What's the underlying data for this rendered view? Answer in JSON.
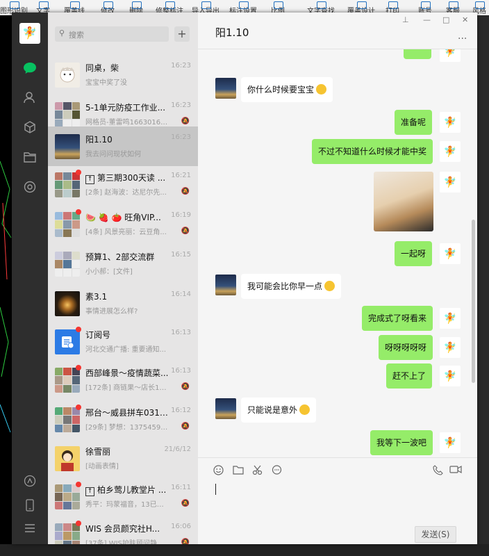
{
  "background_app": {
    "toolbar_items": [
      "图形识别",
      "文字",
      "覆盖线",
      "修改",
      "删除",
      "修整标注",
      "导入导出",
      "标注设置",
      "比例",
      "文字查找",
      "覆盖设计",
      "打印",
      "账号",
      "客服",
      "风格"
    ]
  },
  "window": {
    "title_bar_icons": [
      "pin-icon",
      "minimize-icon",
      "maximize-icon",
      "close-icon"
    ]
  },
  "nav": {
    "icons": [
      "chat-icon",
      "contacts-icon",
      "favorites-icon",
      "files-icon",
      "mini-programs-icon",
      "moments-icon",
      "phone-icon",
      "menu-icon"
    ],
    "active": "chat-icon",
    "accent": "#07c160"
  },
  "search": {
    "placeholder": "搜索",
    "add_button": "+"
  },
  "conversations": [
    {
      "name": "同桌，柴",
      "time": "16:23",
      "preview": "宝宝中奖了没",
      "muted": false,
      "unread_dot": false,
      "avatar": "anime-girl"
    },
    {
      "name": "5-1单元防疫工作业...",
      "time": "16:23",
      "preview": "网格员-董雷鸣16630161...",
      "muted": true,
      "unread_dot": false,
      "avatar": "group-grid"
    },
    {
      "name": "阳1.10",
      "time": "16:23",
      "preview": "我去问问现状如何",
      "muted": false,
      "unread_dot": false,
      "active": true,
      "avatar": "night-sky"
    },
    {
      "name": "第三期300天读 ...",
      "time": "16:21",
      "preview": "[2条] 赵海波：达尼尔先...",
      "muted": true,
      "unread_dot": true,
      "prefix_icon": "pin-box-icon",
      "avatar": "group-grid"
    },
    {
      "name": "🍉 🍓 🍅 旺角VIP...",
      "time": "16:19",
      "preview": "[4条] 风景亮丽：云豆角...",
      "muted": true,
      "unread_dot": true,
      "avatar": "group-grid"
    },
    {
      "name": "预算1、2部交流群",
      "time": "16:15",
      "preview": "小小郝：[文件]",
      "muted": false,
      "unread_dot": false,
      "avatar": "group-grid"
    },
    {
      "name": "素3.1",
      "time": "16:14",
      "preview": "事情进展怎么样?",
      "muted": false,
      "unread_dot": false,
      "avatar": "light-bulb"
    },
    {
      "name": "订阅号",
      "time": "16:13",
      "preview": "河北交通广播: 重要通知...",
      "muted": false,
      "unread_dot": true,
      "avatar": "subscription"
    },
    {
      "name": "西部峰景～疫情蔬菜...",
      "time": "16:13",
      "preview": "[172条] 商链果～店长19...",
      "muted": true,
      "unread_dot": true,
      "avatar": "group-grid"
    },
    {
      "name": "邢台～威县拼车0319...",
      "time": "16:12",
      "preview": "[29条] 梦想：13754592...",
      "muted": true,
      "unread_dot": true,
      "avatar": "group-grid"
    },
    {
      "name": "徐雪丽",
      "time": "21/6/12",
      "preview": "[动画表情]",
      "muted": false,
      "unread_dot": false,
      "avatar": "girl-red"
    },
    {
      "name": "柏乡莺儿教堂片 ...",
      "time": "16:11",
      "preview": "秀平：玛蒙福音，13已读...",
      "muted": true,
      "unread_dot": true,
      "prefix_icon": "pin-box-icon",
      "avatar": "group-grid"
    },
    {
      "name": "WIS 会员颜究社H...",
      "time": "16:06",
      "preview": "[37条] WIS护肤顾问静琪...",
      "muted": true,
      "unread_dot": true,
      "avatar": "group-grid"
    }
  ],
  "chat": {
    "title": "阳1.10",
    "more": "···",
    "messages": [
      {
        "side": "out",
        "text": "",
        "partial": true
      },
      {
        "side": "in",
        "text": "你什么时候要宝宝",
        "emoji": true
      },
      {
        "side": "out",
        "text": "准备呢"
      },
      {
        "side": "out",
        "text": "不过不知道什么时候才能中奖"
      },
      {
        "side": "out",
        "type": "image",
        "text": "cat-photo"
      },
      {
        "side": "out",
        "text": "一起呀"
      },
      {
        "side": "in",
        "text": "我可能会比你早一点",
        "emoji": true
      },
      {
        "side": "out",
        "text": "完成式了呀看来"
      },
      {
        "side": "out",
        "text": "呀呀呀呀呀"
      },
      {
        "side": "out",
        "text": "赶不上了"
      },
      {
        "side": "in",
        "text": "只能说是意外",
        "emoji": true
      },
      {
        "side": "out",
        "text": "我等下一波吧"
      },
      {
        "side": "in",
        "text": "",
        "partial": true
      }
    ],
    "bubble_colors": {
      "out": "#95ec69",
      "in": "#ffffff"
    }
  },
  "composer": {
    "tools": [
      "emoji-icon",
      "folder-icon",
      "scissors-icon",
      "chat-history-icon"
    ],
    "right_tools": [
      "phone-icon",
      "video-icon"
    ],
    "send_label": "发送(S)",
    "input_value": ""
  }
}
